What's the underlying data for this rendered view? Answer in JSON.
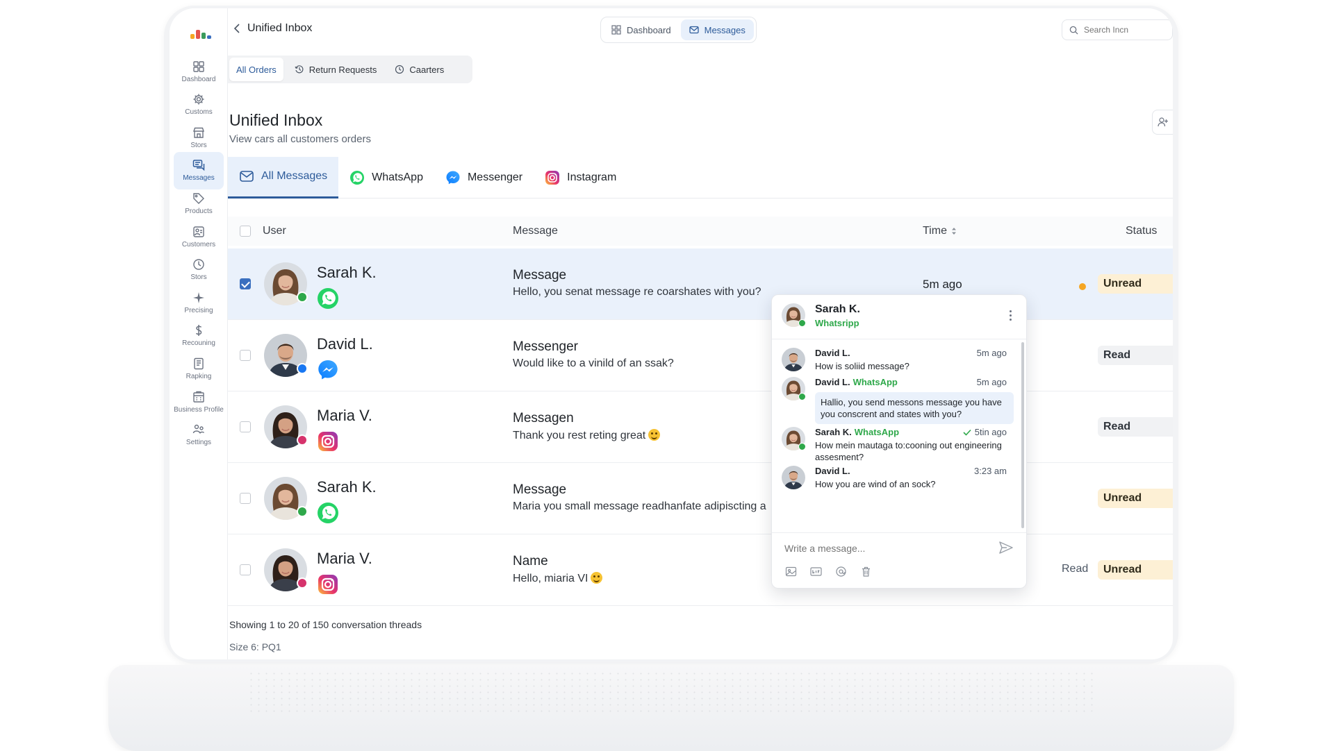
{
  "topbar": {
    "back_label": "Unified Inbox",
    "toggle": [
      {
        "label": "Dashboard",
        "active": false
      },
      {
        "label": "Messages",
        "active": true
      }
    ],
    "search_placeholder": "Search Incn"
  },
  "sidebar": {
    "items": [
      {
        "label": "Dashboard",
        "icon": "grid-icon"
      },
      {
        "label": "Customs",
        "icon": "gear-icon"
      },
      {
        "label": "Stors",
        "icon": "store-icon"
      },
      {
        "label": "Messages",
        "icon": "messages-icon",
        "active": true
      },
      {
        "label": "Products",
        "icon": "tag-icon"
      },
      {
        "label": "Customers",
        "icon": "people-icon"
      },
      {
        "label": "Stors",
        "icon": "clock-icon"
      },
      {
        "label": "Precising",
        "icon": "sparkle-icon"
      },
      {
        "label": "Recouning",
        "icon": "dollar-icon"
      },
      {
        "label": "Rapking",
        "icon": "document-icon"
      },
      {
        "label": "Business Profile",
        "icon": "building-icon"
      },
      {
        "label": "Settings",
        "icon": "team-settings-icon"
      }
    ]
  },
  "order_tabs": [
    {
      "label": "All Orders",
      "active": true
    },
    {
      "label": "Return Requests",
      "icon": "history-icon"
    },
    {
      "label": "Caarters",
      "icon": "clock-icon"
    }
  ],
  "page": {
    "title": "Unified Inbox",
    "subtitle": "View cars all customers orders"
  },
  "channel_tabs": [
    {
      "label": "All Messages",
      "icon": "mail-icon",
      "active": true
    },
    {
      "label": "WhatsApp",
      "icon": "whatsapp-icon"
    },
    {
      "label": "Messenger",
      "icon": "messenger-icon"
    },
    {
      "label": "Instagram",
      "icon": "instagram-icon"
    }
  ],
  "table": {
    "headers": {
      "user": "User",
      "message": "Message",
      "time": "Time",
      "status": "Status"
    },
    "rows": [
      {
        "name": "Sarah K.",
        "channel": "whatsapp",
        "title": "Message",
        "body": "Hello, you senat message re coarshates with you?",
        "emoji": false,
        "time": "5m ago",
        "status": "Unread",
        "dot": true,
        "checked": true,
        "selected": true,
        "avatar": "female-light"
      },
      {
        "name": "David L.",
        "channel": "messenger",
        "title": "Messenger",
        "body": "Would like to a vinild of an ssak?",
        "emoji": false,
        "time": "",
        "status": "Read",
        "checked": false,
        "avatar": "male"
      },
      {
        "name": "Maria V.",
        "channel": "instagram",
        "title": "Messagen",
        "body": "Thank you rest reting great",
        "emoji": true,
        "time": "",
        "status": "Read",
        "checked": false,
        "avatar": "female-dark"
      },
      {
        "name": "Sarah K.",
        "channel": "whatsapp",
        "title": "Message",
        "body": "Maria you small message readhanfate adipiscting a",
        "emoji": false,
        "time": "",
        "status": "Unread",
        "checked": false,
        "avatar": "female-light"
      },
      {
        "name": "Maria V.",
        "channel": "instagram",
        "title": "Name",
        "body": "Hello, miaria VI",
        "emoji": true,
        "time": "",
        "status": "Unread",
        "extra": "Read",
        "checked": false,
        "avatar": "female-dark"
      }
    ]
  },
  "footer": {
    "showing": "Showing 1 to 20 of 150 conversation threads",
    "size": "Size 6: PQ1"
  },
  "chat": {
    "contact_name": "Sarah K.",
    "contact_channel": "Whatsripp",
    "messages": [
      {
        "author": "David L.",
        "channel": "",
        "time": "5m ago",
        "text": "How is soliid message?",
        "bubble": false,
        "avatar": "male"
      },
      {
        "author": "David L.",
        "channel": "WhatsApp",
        "time": "5m ago",
        "text": "Hallio, you send messons message you have you conscrent and states with you?",
        "bubble": true,
        "avatar": "female-light"
      },
      {
        "author": "Sarah K.",
        "channel": "WhatsApp",
        "time": "5tin ago",
        "text": "How mein mautaga to:cooning out engineering assesment?",
        "bubble": false,
        "read_check": true,
        "avatar": "female-light"
      },
      {
        "author": "David L.",
        "channel": "",
        "time": "3:23 am",
        "text": "How you are wind of an sock?",
        "bubble": false,
        "avatar": "male"
      }
    ],
    "composer_placeholder": "Write a message..."
  },
  "colors": {
    "accent": "#2d5b9a",
    "whatsapp": "#25d366",
    "messenger": "#1877f2",
    "unread_bg": "#fdf0d5",
    "unread_dot": "#f5a623"
  }
}
